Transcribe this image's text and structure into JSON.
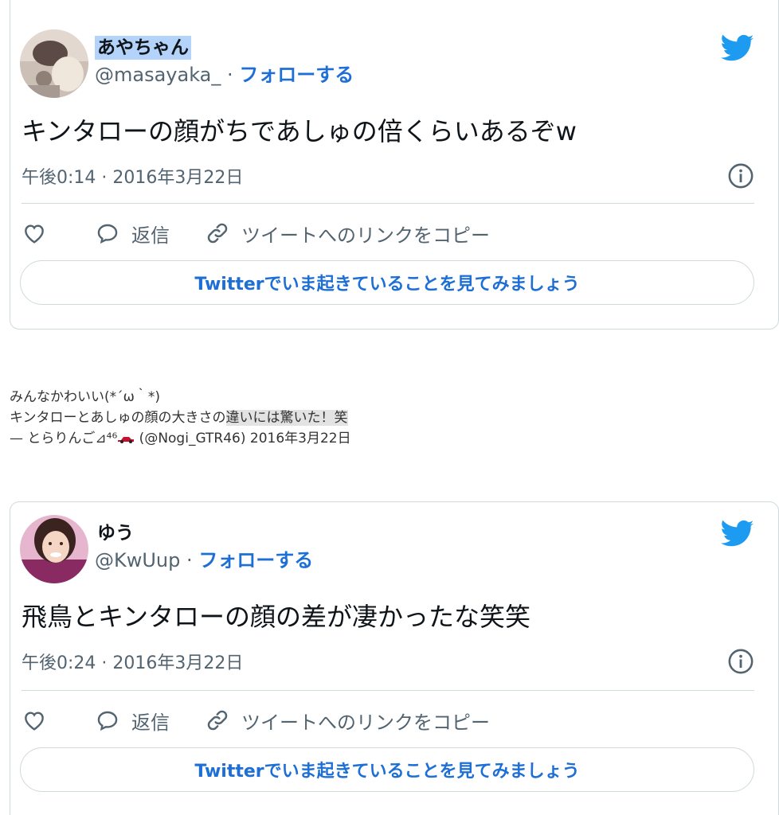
{
  "tweets": [
    {
      "display_name": "あやちゃん",
      "handle": "@masayaka_",
      "separator": "·",
      "follow_label": "フォローする",
      "text": "キンタローの顔がちであしゅの倍くらいあるぞw",
      "timestamp": "午後0:14 · 2016年3月22日",
      "reply_label": "返信",
      "copy_link_label": "ツイートへのリンクをコピー",
      "cta_label": "Twitterでいま起きていることを見てみましょう"
    },
    {
      "display_name": "ゆう",
      "handle": "@KwUup",
      "separator": "·",
      "follow_label": "フォローする",
      "text": "飛鳥とキンタローの顔の差が凄かったな笑笑",
      "timestamp": "午後0:24 · 2016年3月22日",
      "reply_label": "返信",
      "copy_link_label": "ツイートへのリンクをコピー",
      "cta_label": "Twitterでいま起きていることを見てみましょう"
    }
  ],
  "quote": {
    "line1": "みんなかわいい(*´ω｀*)",
    "line2_a": "キンタローとあしゅの顔の大きさの",
    "line2_b": "違いには驚いた！笑",
    "attribution_a": "— とらりんご⊿⁴⁶",
    "attribution_b": " (@Nogi_GTR46) 2016年3月22日"
  },
  "colors": {
    "brand_blue": "#1d9bf0",
    "link_blue": "#1d6fd6",
    "selection": "#b4d3fb"
  },
  "icons": [
    "twitter-bird-icon",
    "info-icon",
    "heart-icon",
    "reply-icon",
    "link-icon"
  ]
}
